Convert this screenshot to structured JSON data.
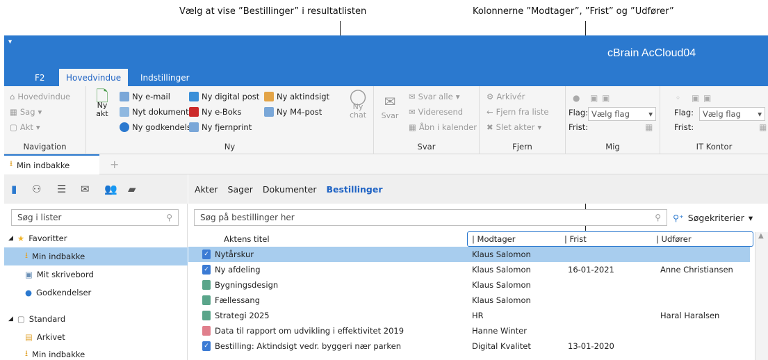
{
  "annotations": {
    "left": "Vælg at vise ”Bestillinger” i resultatlisten",
    "right": "Kolonnerne ”Modtager”, ”Frist” og ”Udfører”"
  },
  "app": {
    "title": "cBrain AcCloud04",
    "menu_glyph": "▾",
    "tabs": [
      "F2",
      "Hovedvindue",
      "Indstillinger"
    ],
    "active_tab": "Hovedvindue"
  },
  "ribbon": {
    "navigation": {
      "label": "Navigation",
      "items": [
        "Hovedvindue",
        "Sag",
        "Akt"
      ]
    },
    "ny": {
      "label": "Ny",
      "big_button": "Ny akt",
      "items": [
        "Ny e-mail",
        "Nyt dokument",
        "Ny godkendelse",
        "Ny digital post",
        "Ny e-Boks",
        "Ny fjernprint",
        "Ny aktindsigt",
        "Ny M4-post"
      ],
      "chat_button": "Ny chat"
    },
    "svar": {
      "label": "Svar",
      "big_button": "Svar",
      "items": [
        "Svar alle",
        "Videresend",
        "Åbn i kalender"
      ]
    },
    "fjern": {
      "label": "Fjern",
      "items": [
        "Arkivér",
        "Fjern fra liste",
        "Slet akter"
      ]
    },
    "mig": {
      "label": "Mig",
      "flag_label": "Flag:",
      "flag_value": "Vælg flag",
      "frist_label": "Frist:"
    },
    "it_kontor": {
      "label": "IT Kontor",
      "flag_label": "Flag:",
      "flag_value": "Vælg flag",
      "frist_label": "Frist:"
    }
  },
  "doc_tab": {
    "label": "Min indbakke",
    "add": "+"
  },
  "left_panel": {
    "search_placeholder": "Søg i lister",
    "favorites_label": "Favoritter",
    "favorites": [
      "Min indbakke",
      "Mit skrivebord",
      "Godkendelser"
    ],
    "standard_label": "Standard",
    "standard": [
      "Arkivet",
      "Min indbakke"
    ]
  },
  "main": {
    "view_tabs": [
      "Akter",
      "Sager",
      "Dokumenter",
      "Bestillinger"
    ],
    "active_view": "Bestillinger",
    "search_placeholder": "Søg på bestillinger her",
    "criteria_label": "Søgekriterier",
    "columns": [
      "Aktens titel",
      "Modtager",
      "Frist",
      "Udfører"
    ],
    "rows": [
      {
        "title": "Nytårskur",
        "modtager": "Klaus Salomon",
        "frist": "",
        "udforer": "",
        "icon": "check",
        "color": "#3b7bd4"
      },
      {
        "title": "Ny afdeling",
        "modtager": "Klaus Salomon",
        "frist": "16-01-2021",
        "udforer": "Anne Christiansen",
        "icon": "check",
        "color": "#3b7bd4"
      },
      {
        "title": "Bygningsdesign",
        "modtager": "Klaus Salomon",
        "frist": "",
        "udforer": "",
        "icon": "doc",
        "color": "#5aa58a"
      },
      {
        "title": "Fællessang",
        "modtager": "Klaus Salomon",
        "frist": "",
        "udforer": "",
        "icon": "doc",
        "color": "#5aa58a"
      },
      {
        "title": "Strategi 2025",
        "modtager": "HR",
        "frist": "",
        "udforer": "Haral Haralsen",
        "icon": "doc",
        "color": "#5aa58a"
      },
      {
        "title": "Data til rapport om udvikling i effektivitet 2019",
        "modtager": "Hanne Winter",
        "frist": "",
        "udforer": "",
        "icon": "doc",
        "color": "#e07f8c"
      },
      {
        "title": "Bestilling: Aktindsigt vedr. byggeri nær parken",
        "modtager": "Digital Kvalitet",
        "frist": "13-01-2020",
        "udforer": "",
        "icon": "check",
        "color": "#3b7bd4"
      }
    ]
  },
  "colors": {
    "brand": "#2b79cf",
    "selection": "#a8cdee",
    "active_text": "#1f63c4"
  }
}
